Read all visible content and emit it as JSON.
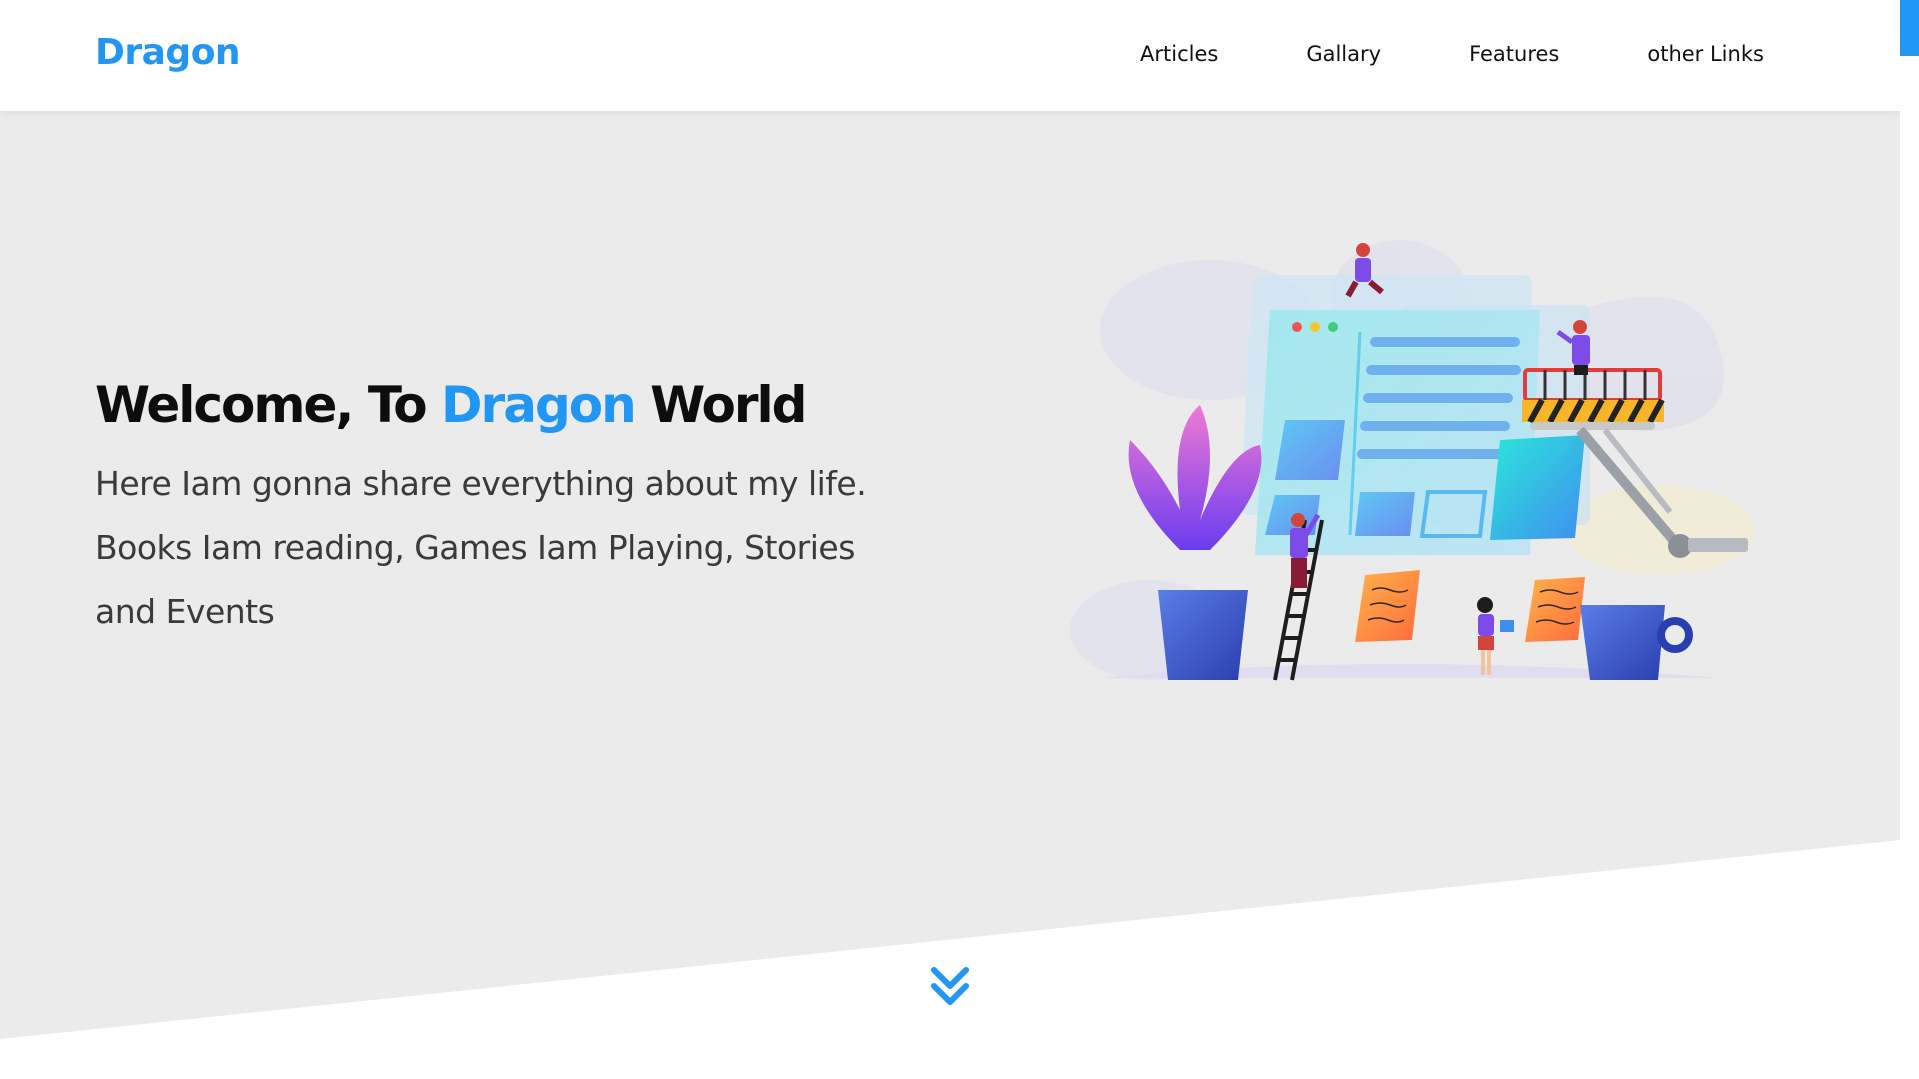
{
  "brand": {
    "name": "Dragon",
    "accent_color": "#2196f3"
  },
  "nav": {
    "items": [
      {
        "label": "Articles"
      },
      {
        "label": "Gallary"
      },
      {
        "label": "Features"
      },
      {
        "label": "other Links"
      }
    ]
  },
  "hero": {
    "title_prefix": "Welcome, To ",
    "title_accent": "Dragon",
    "title_suffix": " World",
    "description": "Here Iam gonna share everything about my life. Books Iam reading, Games Iam Playing, Stories and Events",
    "background_color": "#ebebeb",
    "illustration_icon": "web-development-illustration"
  },
  "scroll_indicator": {
    "icon": "double-chevron-down-icon"
  }
}
